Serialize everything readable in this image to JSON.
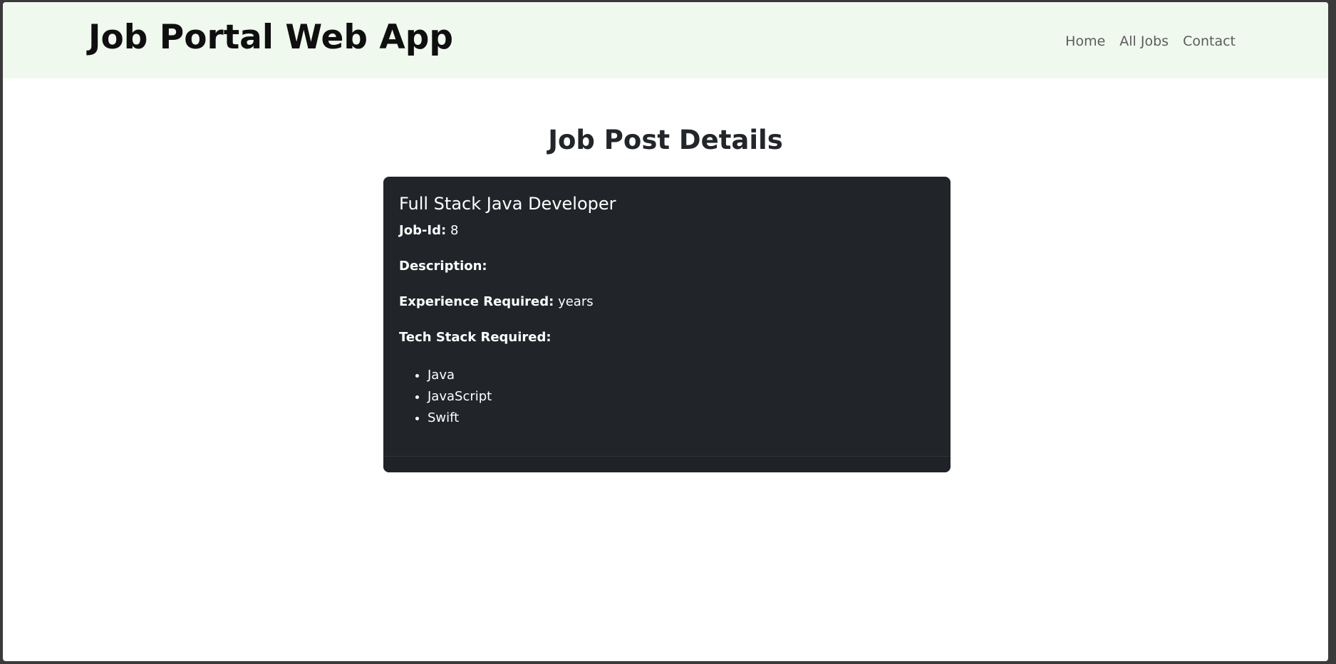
{
  "navbar": {
    "brand": "Job Portal Web App",
    "links": [
      "Home",
      "All Jobs",
      "Contact"
    ]
  },
  "page": {
    "title": "Job Post Details"
  },
  "job": {
    "title": "Full Stack Java Developer",
    "id_label": "Job-Id:",
    "id_value": "8",
    "description_label": "Description:",
    "description_value": "",
    "experience_label": "Experience Required:",
    "experience_value": "years",
    "tech_label": "Tech Stack Required:",
    "tech_stack": [
      "Java",
      "JavaScript",
      "Swift"
    ]
  }
}
